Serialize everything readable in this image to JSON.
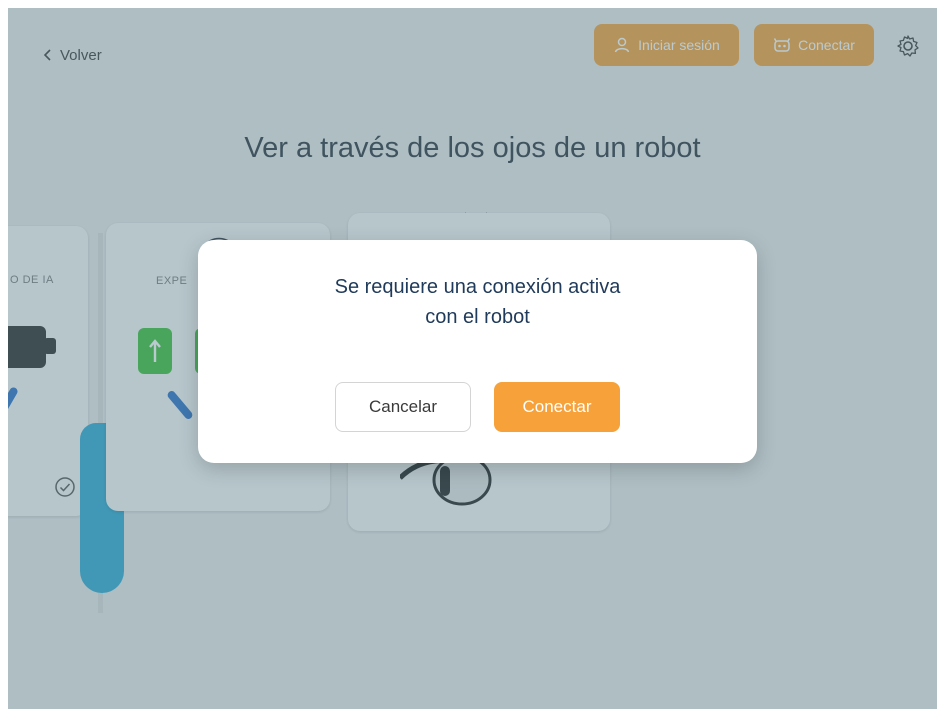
{
  "header": {
    "back_label": "Volver",
    "login_label": "Iniciar sesión",
    "connect_label": "Conectar"
  },
  "page": {
    "title": "Ver a través de los ojos de un robot"
  },
  "cards": {
    "left_label": "O DE IA",
    "mid_label": "EXPE"
  },
  "dialog": {
    "message_line1": "Se requiere una conexión activa",
    "message_line2": "con el robot",
    "cancel_label": "Cancelar",
    "confirm_label": "Conectar"
  },
  "colors": {
    "accent": "#f6a13a",
    "overlay": "#5a808c",
    "dialog_text": "#1f3a5a"
  },
  "icons": [
    "chevron-left-icon",
    "user-icon",
    "robot-icon",
    "gear-icon",
    "check-circle-icon",
    "arrow-up-icon"
  ]
}
